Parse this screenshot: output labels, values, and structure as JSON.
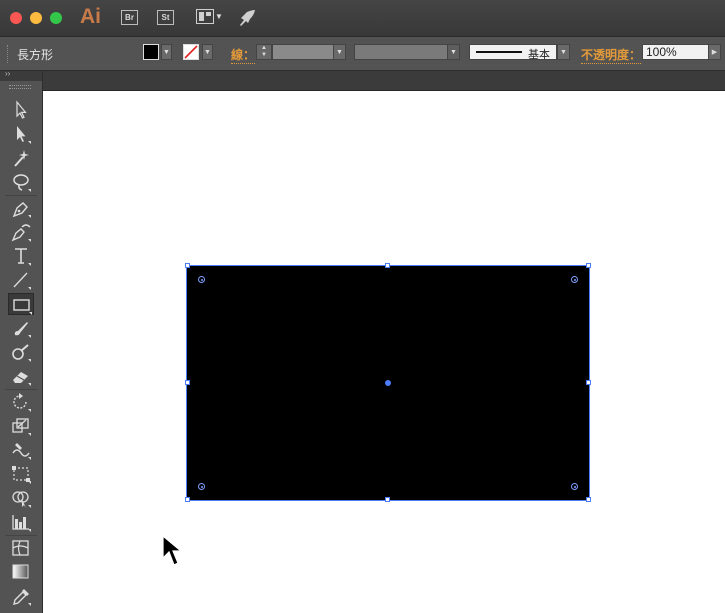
{
  "app": {
    "logo": "Ai",
    "bridge_label": "Br",
    "stock_label": "St"
  },
  "control": {
    "selection_type": "長方形",
    "stroke_label": "線：",
    "profile_label": "基本",
    "opacity_label": "不透明度：",
    "opacity_value": "100%"
  },
  "colors": {
    "selection": "#4d7cf7",
    "accent_label": "#e39a3a",
    "shape_fill": "#000000"
  },
  "tools": [
    "selection-tool-icon",
    "direct-selection-tool-icon",
    "magic-wand-tool-icon",
    "lasso-tool-icon",
    "pen-tool-icon",
    "curvature-tool-icon",
    "type-tool-icon",
    "line-segment-tool-icon",
    "rectangle-tool-icon",
    "paintbrush-tool-icon",
    "blob-brush-tool-icon",
    "eraser-tool-icon",
    "rotate-tool-icon",
    "scale-tool-icon",
    "warp-tool-icon",
    "free-transform-tool-icon",
    "shape-builder-tool-icon",
    "graph-tool-icon",
    "mesh-tool-icon",
    "gradient-tool-icon",
    "eyedropper-tool-icon"
  ]
}
